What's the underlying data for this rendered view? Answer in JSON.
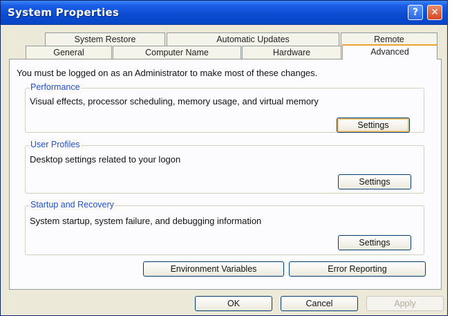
{
  "window": {
    "title": "System Properties",
    "help_label": "?",
    "close_label": "✕"
  },
  "tabs": {
    "row_back": [
      "System Restore",
      "Automatic Updates",
      "Remote"
    ],
    "row_front": [
      "General",
      "Computer Name",
      "Hardware",
      "Advanced"
    ],
    "active": "Advanced"
  },
  "advanced": {
    "admin_note": "You must be logged on as an Administrator to make most of these changes.",
    "performance": {
      "title": "Performance",
      "description": "Visual effects, processor scheduling, memory usage, and virtual memory",
      "button": "Settings"
    },
    "user_profiles": {
      "title": "User Profiles",
      "description": "Desktop settings related to your logon",
      "button": "Settings"
    },
    "startup_recovery": {
      "title": "Startup and Recovery",
      "description": "System startup, system failure, and debugging information",
      "button": "Settings"
    },
    "environment_variables": "Environment Variables",
    "error_reporting": "Error Reporting"
  },
  "footer": {
    "ok": "OK",
    "cancel": "Cancel",
    "apply": "Apply"
  }
}
